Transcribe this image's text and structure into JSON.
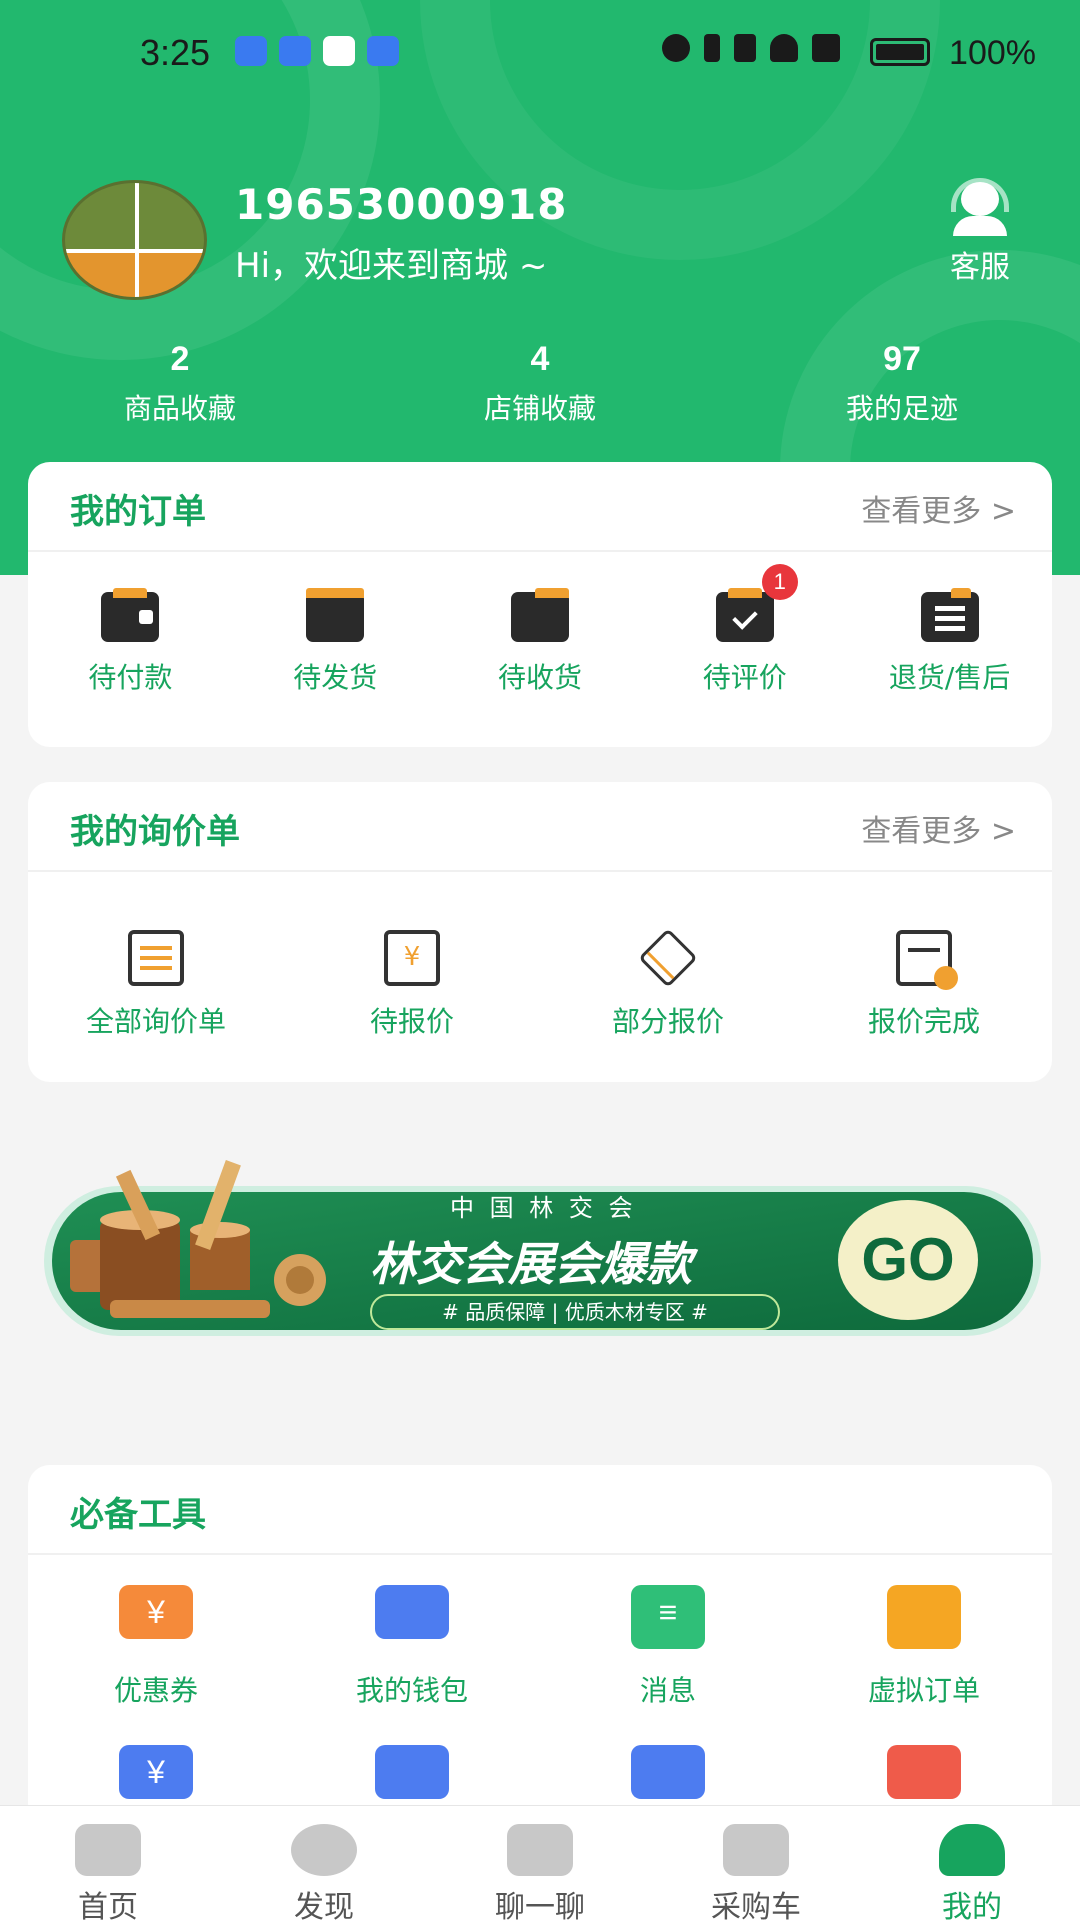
{
  "status_bar": {
    "time": "3:25",
    "battery": "100%"
  },
  "profile": {
    "phone": "19653000918",
    "greeting": "Hi，欢迎来到商城 ~",
    "service_label": "客服"
  },
  "stats": [
    {
      "value": "2",
      "label": "商品收藏"
    },
    {
      "value": "4",
      "label": "店铺收藏"
    },
    {
      "value": "97",
      "label": "我的足迹"
    }
  ],
  "orders": {
    "title": "我的订单",
    "more": "查看更多 >",
    "items": [
      {
        "label": "待付款",
        "icon": "wallet-icon"
      },
      {
        "label": "待发货",
        "icon": "box-icon"
      },
      {
        "label": "待收货",
        "icon": "receive-icon"
      },
      {
        "label": "待评价",
        "icon": "review-icon",
        "badge": "1"
      },
      {
        "label": "退货/售后",
        "icon": "return-icon"
      }
    ]
  },
  "inquiries": {
    "title": "我的询价单",
    "more": "查看更多 >",
    "items": [
      {
        "label": "全部询价单",
        "icon": "clipboard-icon"
      },
      {
        "label": "待报价",
        "icon": "quote-bubble-icon"
      },
      {
        "label": "部分报价",
        "icon": "layers-icon"
      },
      {
        "label": "报价完成",
        "icon": "doc-check-icon"
      }
    ]
  },
  "banner": {
    "org": "中 国 林 交 会",
    "headline": "林交会展会爆款",
    "tagline": "# 品质保障 | 优质木材专区 #",
    "cta": "GO"
  },
  "tools": {
    "title": "必备工具",
    "items": [
      {
        "label": "优惠券",
        "icon": "coupon-icon",
        "color": "#f58a3a"
      },
      {
        "label": "我的钱包",
        "icon": "wallet-icon",
        "color": "#4d7cf0"
      },
      {
        "label": "消息",
        "icon": "message-icon",
        "color": "#2fbf78"
      },
      {
        "label": "虚拟订单",
        "icon": "cloud-order-icon",
        "color": "#f5a623"
      }
    ]
  },
  "tabbar": [
    {
      "label": "首页",
      "icon": "home-icon"
    },
    {
      "label": "发现",
      "icon": "compass-icon"
    },
    {
      "label": "聊一聊",
      "icon": "chat-icon"
    },
    {
      "label": "采购车",
      "icon": "cart-icon"
    },
    {
      "label": "我的",
      "icon": "user-icon",
      "active": true
    }
  ],
  "colors": {
    "brand": "#22b86e",
    "accent_text": "#17a45e",
    "badge": "#e8363c"
  }
}
